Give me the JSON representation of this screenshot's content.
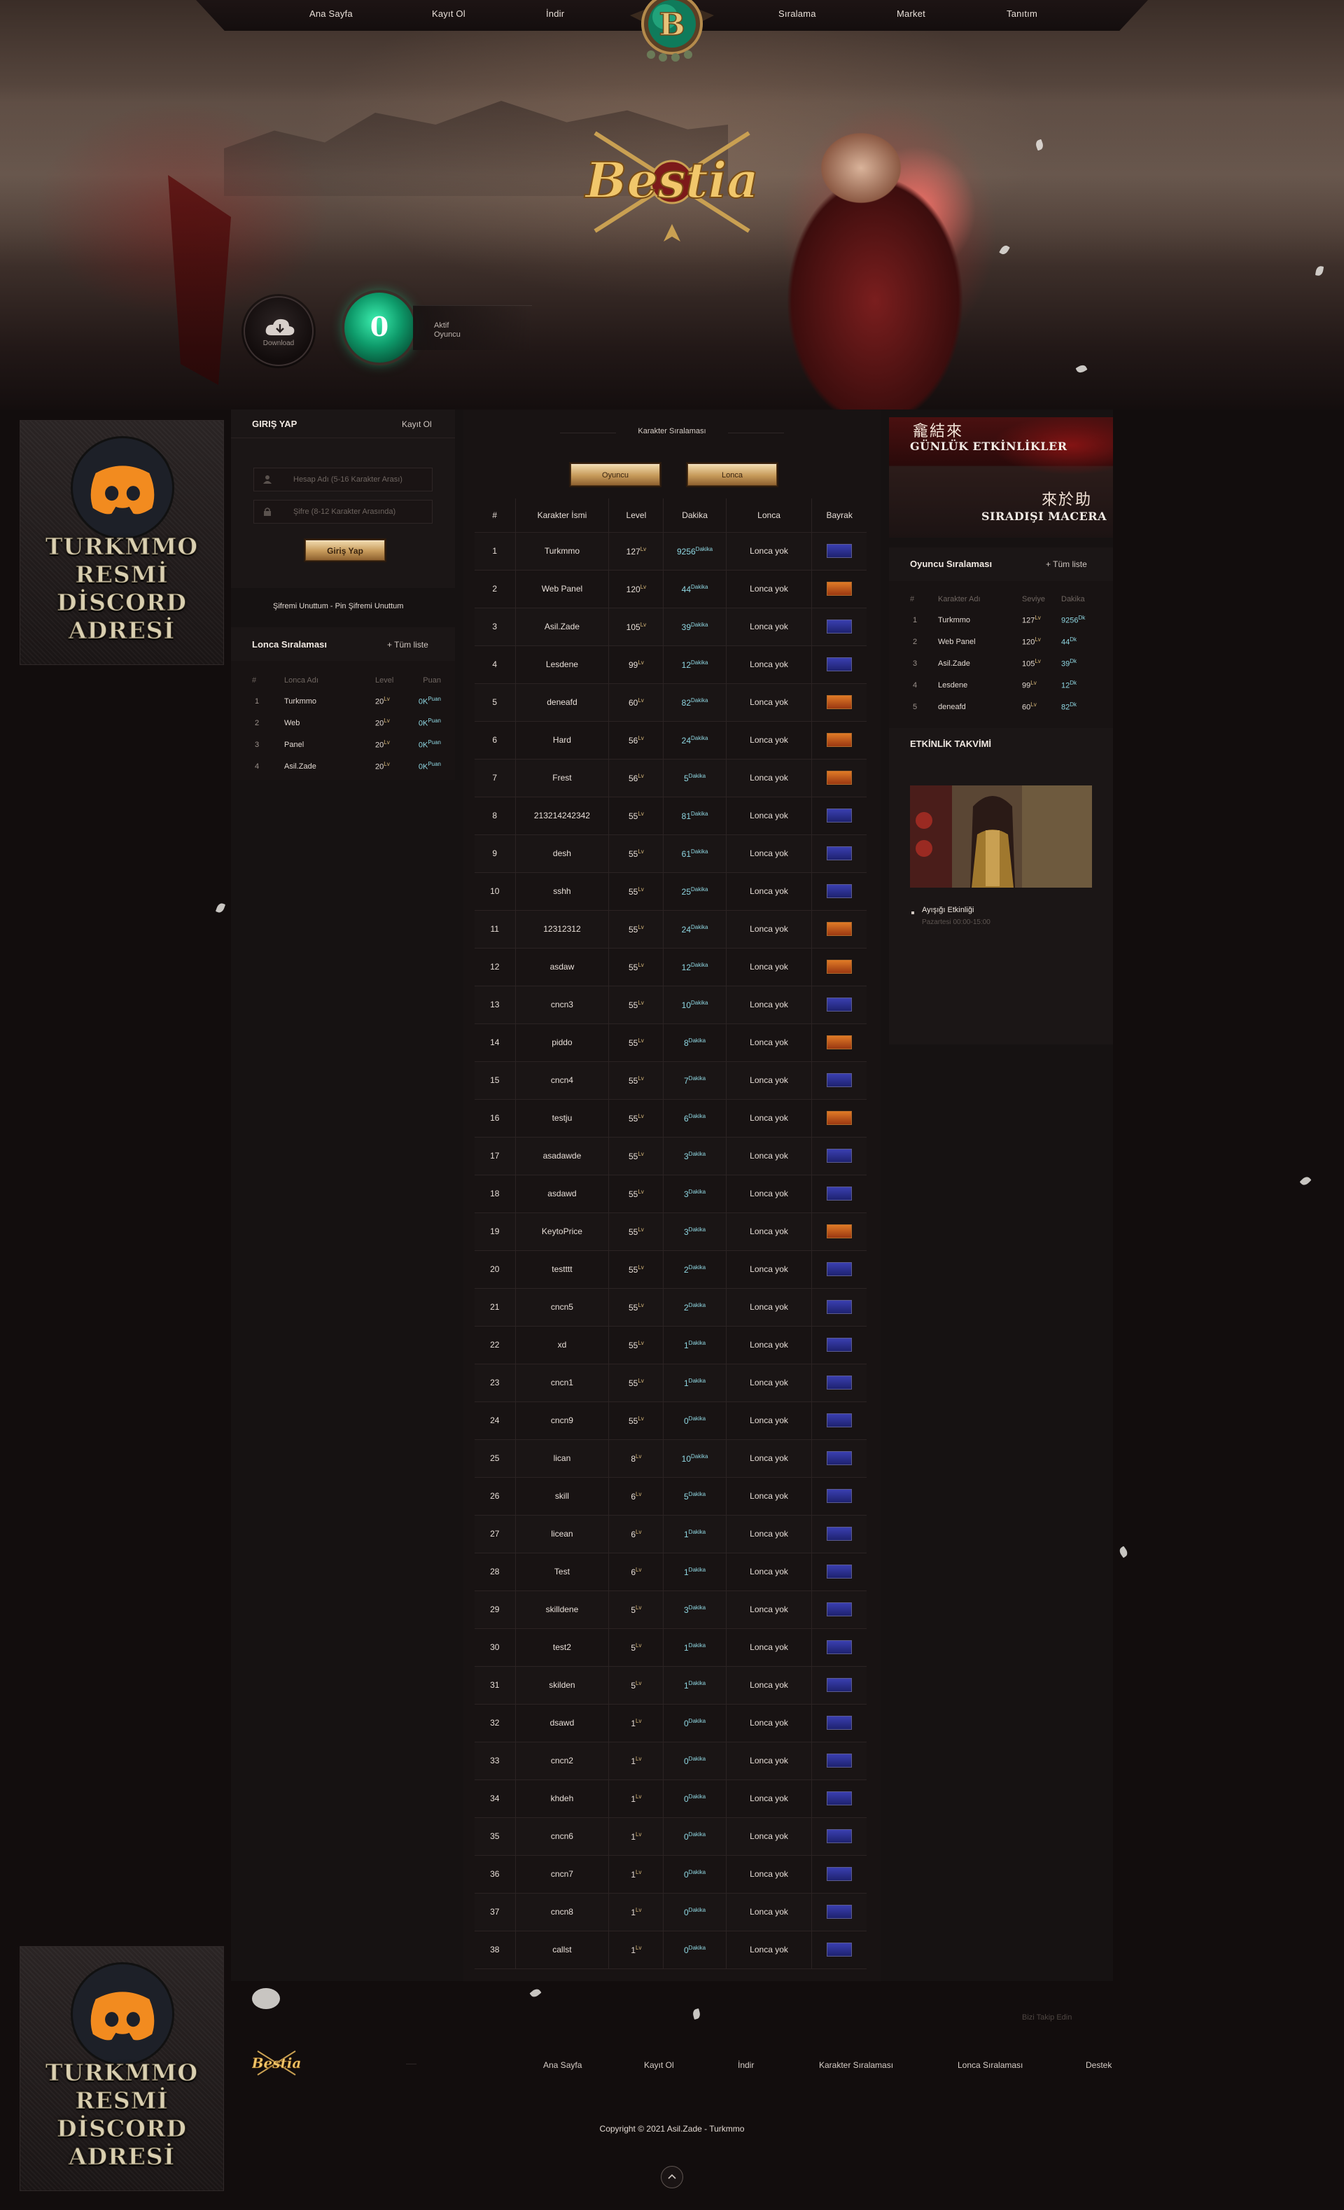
{
  "nav": {
    "items": [
      "Ana Sayfa",
      "Kayıt Ol",
      "İndir",
      "Sıralama",
      "Market",
      "Tanıtım"
    ],
    "logo_letter": "B"
  },
  "hero": {
    "download_label": "Download",
    "online_count": "0",
    "online_label_1": "Aktif",
    "online_label_2": "Oyuncu",
    "brand_name": "Bestia"
  },
  "discord_ad": {
    "lines": [
      "TURKMMO",
      "RESMİ",
      "DİSCORD",
      "ADRESİ"
    ]
  },
  "login": {
    "title": "GIRIŞ YAP",
    "register_link": "Kayıt Ol",
    "username_placeholder": "Hesap Adı (5-16 Karakter Arası)",
    "password_placeholder": "Şifre (8-12 Karakter Arasında)",
    "submit_label": "Giriş Yap",
    "forgot_text": "Şifremi Unuttum - Pin Şifremi Unuttum"
  },
  "guild_ranking": {
    "title": "Lonca Sıralaması",
    "all_link": "+ Tüm liste",
    "headers": [
      "#",
      "Lonca Adı",
      "Level",
      "Puan"
    ],
    "level_suffix": "Lv",
    "points_suffix": "Puan",
    "rows": [
      {
        "rank": "1",
        "name": "Turkmmo",
        "level": "20",
        "points": "0K"
      },
      {
        "rank": "2",
        "name": "Web",
        "level": "20",
        "points": "0K"
      },
      {
        "rank": "3",
        "name": "Panel",
        "level": "20",
        "points": "0K"
      },
      {
        "rank": "4",
        "name": "Asil.Zade",
        "level": "20",
        "points": "0K"
      }
    ]
  },
  "character_ranking": {
    "title": "Karakter Sıralaması",
    "tab_player": "Oyuncu",
    "tab_guild": "Lonca",
    "headers": [
      "#",
      "Karakter İsmi",
      "Level",
      "Dakika",
      "Lonca",
      "Bayrak"
    ],
    "level_suffix": "Lv",
    "minute_suffix": "Dakika",
    "guild_none": "Lonca yok",
    "rows": [
      {
        "rank": "1",
        "name": "Turkmmo",
        "level": "127",
        "minutes": "9256",
        "flag": "blue"
      },
      {
        "rank": "2",
        "name": "Web Panel",
        "level": "120",
        "minutes": "44",
        "flag": "red"
      },
      {
        "rank": "3",
        "name": "Asil.Zade",
        "level": "105",
        "minutes": "39",
        "flag": "blue"
      },
      {
        "rank": "4",
        "name": "Lesdene",
        "level": "99",
        "minutes": "12",
        "flag": "blue"
      },
      {
        "rank": "5",
        "name": "deneafd",
        "level": "60",
        "minutes": "82",
        "flag": "red"
      },
      {
        "rank": "6",
        "name": "Hard",
        "level": "56",
        "minutes": "24",
        "flag": "red"
      },
      {
        "rank": "7",
        "name": "Frest",
        "level": "56",
        "minutes": "5",
        "flag": "red"
      },
      {
        "rank": "8",
        "name": "213214242342",
        "level": "55",
        "minutes": "81",
        "flag": "blue"
      },
      {
        "rank": "9",
        "name": "desh",
        "level": "55",
        "minutes": "61",
        "flag": "blue"
      },
      {
        "rank": "10",
        "name": "sshh",
        "level": "55",
        "minutes": "25",
        "flag": "blue"
      },
      {
        "rank": "11",
        "name": "12312312",
        "level": "55",
        "minutes": "24",
        "flag": "red"
      },
      {
        "rank": "12",
        "name": "asdaw",
        "level": "55",
        "minutes": "12",
        "flag": "red"
      },
      {
        "rank": "13",
        "name": "cncn3",
        "level": "55",
        "minutes": "10",
        "flag": "blue"
      },
      {
        "rank": "14",
        "name": "piddo",
        "level": "55",
        "minutes": "8",
        "flag": "red"
      },
      {
        "rank": "15",
        "name": "cncn4",
        "level": "55",
        "minutes": "7",
        "flag": "blue"
      },
      {
        "rank": "16",
        "name": "testju",
        "level": "55",
        "minutes": "6",
        "flag": "red"
      },
      {
        "rank": "17",
        "name": "asadawde",
        "level": "55",
        "minutes": "3",
        "flag": "blue"
      },
      {
        "rank": "18",
        "name": "asdawd",
        "level": "55",
        "minutes": "3",
        "flag": "blue"
      },
      {
        "rank": "19",
        "name": "KeytoPrice",
        "level": "55",
        "minutes": "3",
        "flag": "red"
      },
      {
        "rank": "20",
        "name": "testttt",
        "level": "55",
        "minutes": "2",
        "flag": "blue"
      },
      {
        "rank": "21",
        "name": "cncn5",
        "level": "55",
        "minutes": "2",
        "flag": "blue"
      },
      {
        "rank": "22",
        "name": "xd",
        "level": "55",
        "minutes": "1",
        "flag": "blue"
      },
      {
        "rank": "23",
        "name": "cncn1",
        "level": "55",
        "minutes": "1",
        "flag": "blue"
      },
      {
        "rank": "24",
        "name": "cncn9",
        "level": "55",
        "minutes": "0",
        "flag": "blue"
      },
      {
        "rank": "25",
        "name": "lican",
        "level": "8",
        "minutes": "10",
        "flag": "blue"
      },
      {
        "rank": "26",
        "name": "skill",
        "level": "6",
        "minutes": "5",
        "flag": "blue"
      },
      {
        "rank": "27",
        "name": "licean",
        "level": "6",
        "minutes": "1",
        "flag": "blue"
      },
      {
        "rank": "28",
        "name": "Test",
        "level": "6",
        "minutes": "1",
        "flag": "blue"
      },
      {
        "rank": "29",
        "name": "skilldene",
        "level": "5",
        "minutes": "3",
        "flag": "blue"
      },
      {
        "rank": "30",
        "name": "test2",
        "level": "5",
        "minutes": "1",
        "flag": "blue"
      },
      {
        "rank": "31",
        "name": "skilden",
        "level": "5",
        "minutes": "1",
        "flag": "blue"
      },
      {
        "rank": "32",
        "name": "dsawd",
        "level": "1",
        "minutes": "0",
        "flag": "blue"
      },
      {
        "rank": "33",
        "name": "cncn2",
        "level": "1",
        "minutes": "0",
        "flag": "blue"
      },
      {
        "rank": "34",
        "name": "khdeh",
        "level": "1",
        "minutes": "0",
        "flag": "blue"
      },
      {
        "rank": "35",
        "name": "cncn6",
        "level": "1",
        "minutes": "0",
        "flag": "blue"
      },
      {
        "rank": "36",
        "name": "cncn7",
        "level": "1",
        "minutes": "0",
        "flag": "blue"
      },
      {
        "rank": "37",
        "name": "cncn8",
        "level": "1",
        "minutes": "0",
        "flag": "blue"
      },
      {
        "rank": "38",
        "name": "callst",
        "level": "1",
        "minutes": "0",
        "flag": "blue"
      }
    ]
  },
  "events_banner": {
    "calligraphy_1": "龕結來",
    "title_1": "GÜNLÜK ETKİNLİKLER",
    "calligraphy_2": "來於助",
    "title_2": "SIRADIŞI MACERA"
  },
  "player_ranking": {
    "title": "Oyuncu Sıralaması",
    "all_link": "+ Tüm liste",
    "headers": [
      "#",
      "Karakter Adı",
      "Seviye",
      "Dakika"
    ],
    "level_suffix": "Lv",
    "minute_suffix": "Dk",
    "rows": [
      {
        "rank": "1",
        "name": "Turkmmo",
        "level": "127",
        "minutes": "9256"
      },
      {
        "rank": "2",
        "name": "Web Panel",
        "level": "120",
        "minutes": "44"
      },
      {
        "rank": "3",
        "name": "Asil.Zade",
        "level": "105",
        "minutes": "39"
      },
      {
        "rank": "4",
        "name": "Lesdene",
        "level": "99",
        "minutes": "12"
      },
      {
        "rank": "5",
        "name": "deneafd",
        "level": "60",
        "minutes": "82"
      }
    ]
  },
  "event_calendar": {
    "title": "ETKİNLİK TAKVİMİ",
    "event_name": "Ayışığı Etkinliği",
    "event_time": "Pazartesi 00:00-15:00"
  },
  "footer": {
    "follow": "Bizi Takip Edin",
    "links": [
      "Ana Sayfa",
      "Kayıt Ol",
      "İndir",
      "Karakter Sıralaması",
      "Lonca Sıralaması",
      "Destek"
    ],
    "copyright": "Copyright © 2021 Asil.Zade - Turkmmo",
    "brand": "Bestia"
  },
  "colors": {
    "background": "#120d0d",
    "gold": "#c69a5a",
    "accent_blue": "#8fd7e2",
    "orb_green": "#0e9a6a"
  }
}
